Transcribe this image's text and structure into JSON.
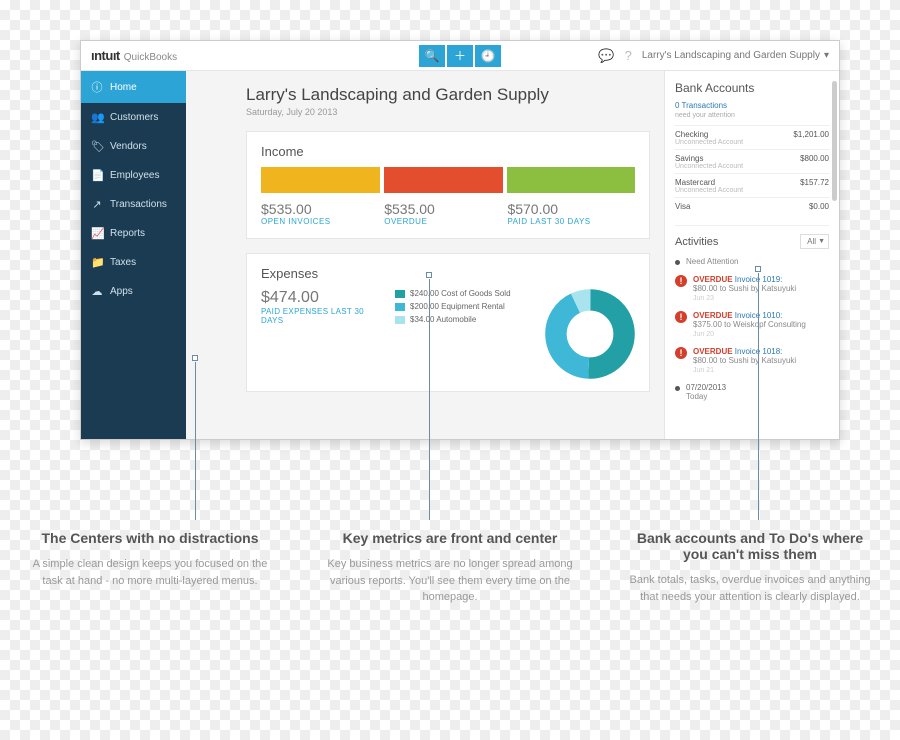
{
  "topbar": {
    "brand_logo": "ıntuıt",
    "brand_sub": "QuickBooks",
    "company_name": "Larry's Landscaping and Garden Supply"
  },
  "sidebar": {
    "items": [
      {
        "label": "Home",
        "icon": "ⓘ"
      },
      {
        "label": "Customers",
        "icon": "👥"
      },
      {
        "label": "Vendors",
        "icon": "🏷"
      },
      {
        "label": "Employees",
        "icon": "📄"
      },
      {
        "label": "Transactions",
        "icon": "↗"
      },
      {
        "label": "Reports",
        "icon": "📈"
      },
      {
        "label": "Taxes",
        "icon": "📁"
      },
      {
        "label": "Apps",
        "icon": "☁"
      }
    ]
  },
  "header": {
    "title": "Larry's Landscaping and Garden Supply",
    "date": "Saturday, July 20 2013"
  },
  "income": {
    "title": "Income",
    "metrics": [
      {
        "amount": "$535.00",
        "label": "OPEN INVOICES"
      },
      {
        "amount": "$535.00",
        "label": "OVERDUE"
      },
      {
        "amount": "$570.00",
        "label": "PAID LAST 30 DAYS"
      }
    ]
  },
  "expenses": {
    "title": "Expenses",
    "amount": "$474.00",
    "label": "PAID EXPENSES LAST 30 DAYS",
    "legend": [
      {
        "color": "#22a0a6",
        "text": "$240.00 Cost of Goods Sold"
      },
      {
        "color": "#3fb8d8",
        "text": "$200.00 Equipment Rental"
      },
      {
        "color": "#a8e3ee",
        "text": "$34.00 Automobile"
      }
    ]
  },
  "bank": {
    "title": "Bank Accounts",
    "notice": "0 Transactions",
    "notice_sub": "need your attention",
    "accounts": [
      {
        "name": "Checking",
        "sub": "Unconnected Account",
        "bal": "$1,201.00"
      },
      {
        "name": "Savings",
        "sub": "Unconnected Account",
        "bal": "$800.00"
      },
      {
        "name": "Mastercard",
        "sub": "Unconnected Account",
        "bal": "$157.72"
      },
      {
        "name": "Visa",
        "sub": "",
        "bal": "$0.00"
      }
    ]
  },
  "activities": {
    "title": "Activities",
    "filter": "All",
    "need_attention": "Need Attention",
    "items": [
      {
        "overdue": "OVERDUE",
        "link": "Invoice 1019:",
        "sub": "$80.00 to Sushi by Katsuyuki",
        "date": "Jun 23"
      },
      {
        "overdue": "OVERDUE",
        "link": "Invoice 1010:",
        "sub": "$375.00 to Weiskopf Consulting",
        "date": "Jun 20"
      },
      {
        "overdue": "OVERDUE",
        "link": "Invoice 1018:",
        "sub": "$80.00 to Sushi by Katsuyuki",
        "date": "Jun 21"
      }
    ],
    "today": {
      "date": "07/20/2013",
      "label": "Today"
    }
  },
  "annotations": [
    {
      "title": "The Centers with no distractions",
      "body": "A simple clean design keeps you focused on the task at hand - no more multi-layered menus."
    },
    {
      "title": "Key metrics are front and center",
      "body": "Key business metrics are no longer spread among various reports. You'll see them every time on the homepage."
    },
    {
      "title": "Bank accounts and To Do's where you can't miss them",
      "body": "Bank totals, tasks, overdue invoices and anything that needs your attention is clearly displayed."
    }
  ],
  "chart_data": [
    {
      "type": "bar",
      "title": "Income",
      "categories": [
        "Open Invoices",
        "Overdue",
        "Paid Last 30 Days"
      ],
      "values": [
        535.0,
        535.0,
        570.0
      ],
      "colors": [
        "#f0b41e",
        "#e24e2e",
        "#8cbf3f"
      ],
      "ylabel": "USD"
    },
    {
      "type": "pie",
      "title": "Expenses",
      "categories": [
        "Cost of Goods Sold",
        "Equipment Rental",
        "Automobile"
      ],
      "values": [
        240.0,
        200.0,
        34.0
      ],
      "colors": [
        "#22a0a6",
        "#3fb8d8",
        "#a8e3ee"
      ],
      "total": 474.0
    }
  ]
}
